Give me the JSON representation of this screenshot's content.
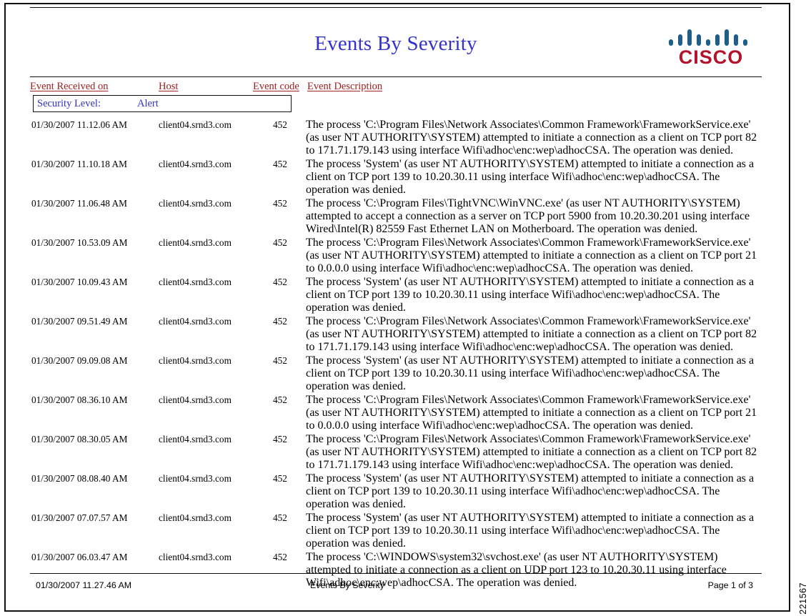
{
  "report": {
    "title": "Events By Severity",
    "logo": {
      "name": "cisco-logo",
      "wordmark": "CISCO",
      "bar_color": "#1d5f8a",
      "wordmark_color": "#b4122a"
    },
    "title_color": "#3333cc",
    "header_color": "#a02020"
  },
  "columns": {
    "received_on": "Event Received on",
    "host": "Host",
    "event_code": "Event code",
    "description": "Event Description"
  },
  "security_level": {
    "label": "Security Level:",
    "value": "Alert",
    "color": "#3333cc"
  },
  "rows": [
    {
      "time": "01/30/2007 11.12.06 AM",
      "host": "client04.srnd3.com",
      "code": "452",
      "description": "The process 'C:\\Program Files\\Network Associates\\Common Framework\\FrameworkService.exe' (as user NT AUTHORITY\\SYSTEM) attempted to initiate a connection as a client on TCP port 82 to 171.71.179.143 using interface Wifi\\adhoc\\enc:wep\\adhocCSA. The operation was denied."
    },
    {
      "time": "01/30/2007 11.10.18 AM",
      "host": "client04.srnd3.com",
      "code": "452",
      "description": "The process 'System' (as user NT AUTHORITY\\SYSTEM) attempted to initiate a connection as a client on TCP port 139 to 10.20.30.11 using interface Wifi\\adhoc\\enc:wep\\adhocCSA. The operation was denied."
    },
    {
      "time": "01/30/2007 11.06.48 AM",
      "host": "client04.srnd3.com",
      "code": "452",
      "description": "The process 'C:\\Program Files\\TightVNC\\WinVNC.exe' (as user NT AUTHORITY\\SYSTEM) attempted to accept a connection as a server on TCP port 5900 from 10.20.30.201 using interface Wired\\Intel(R) 82559 Fast Ethernet LAN on Motherboard. The operation was denied."
    },
    {
      "time": "01/30/2007 10.53.09 AM",
      "host": "client04.srnd3.com",
      "code": "452",
      "description": "The process 'C:\\Program Files\\Network Associates\\Common Framework\\FrameworkService.exe' (as user NT AUTHORITY\\SYSTEM) attempted to initiate a connection as a client on TCP port 21 to 0.0.0.0 using interface Wifi\\adhoc\\enc:wep\\adhocCSA. The operation was denied."
    },
    {
      "time": "01/30/2007 10.09.43 AM",
      "host": "client04.srnd3.com",
      "code": "452",
      "description": "The process 'System' (as user NT AUTHORITY\\SYSTEM) attempted to initiate a connection as a client on TCP port 139 to 10.20.30.11 using interface Wifi\\adhoc\\enc:wep\\adhocCSA. The operation was denied."
    },
    {
      "time": "01/30/2007 09.51.49 AM",
      "host": "client04.srnd3.com",
      "code": "452",
      "description": "The process 'C:\\Program Files\\Network Associates\\Common Framework\\FrameworkService.exe' (as user NT AUTHORITY\\SYSTEM) attempted to initiate a connection as a client on TCP port 82 to 171.71.179.143 using interface Wifi\\adhoc\\enc:wep\\adhocCSA. The operation was denied."
    },
    {
      "time": "01/30/2007 09.09.08 AM",
      "host": "client04.srnd3.com",
      "code": "452",
      "description": "The process 'System' (as user NT AUTHORITY\\SYSTEM) attempted to initiate a connection as a client on TCP port 139 to 10.20.30.11 using interface Wifi\\adhoc\\enc:wep\\adhocCSA. The operation was denied."
    },
    {
      "time": "01/30/2007 08.36.10 AM",
      "host": "client04.srnd3.com",
      "code": "452",
      "description": "The process 'C:\\Program Files\\Network Associates\\Common Framework\\FrameworkService.exe' (as user NT AUTHORITY\\SYSTEM) attempted to initiate a connection as a client on TCP port 21 to 0.0.0.0 using interface Wifi\\adhoc\\enc:wep\\adhocCSA. The operation was denied."
    },
    {
      "time": "01/30/2007 08.30.05 AM",
      "host": "client04.srnd3.com",
      "code": "452",
      "description": "The process 'C:\\Program Files\\Network Associates\\Common Framework\\FrameworkService.exe' (as user NT AUTHORITY\\SYSTEM) attempted to initiate a connection as a client on TCP port 82 to 171.71.179.143 using interface Wifi\\adhoc\\enc:wep\\adhocCSA. The operation was denied."
    },
    {
      "time": "01/30/2007 08.08.40 AM",
      "host": "client04.srnd3.com",
      "code": "452",
      "description": "The process 'System' (as user NT AUTHORITY\\SYSTEM) attempted to initiate a connection as a client on TCP port 139 to 10.20.30.11 using interface Wifi\\adhoc\\enc:wep\\adhocCSA. The operation was denied."
    },
    {
      "time": "01/30/2007 07.07.57 AM",
      "host": "client04.srnd3.com",
      "code": "452",
      "description": "The process 'System' (as user NT AUTHORITY\\SYSTEM) attempted to initiate a connection as a client on TCP port 139 to 10.20.30.11 using interface Wifi\\adhoc\\enc:wep\\adhocCSA. The operation was denied."
    },
    {
      "time": "01/30/2007 06.03.47 AM",
      "host": "client04.srnd3.com",
      "code": "452",
      "description": "The process 'C:\\WINDOWS\\system32\\svchost.exe' (as user NT AUTHORITY\\SYSTEM) attempted to initiate a connection as a client on UDP port 123 to 10.20.30.11 using interface Wifi\\adhoc\\enc:wep\\adhocCSA. The operation was denied."
    }
  ],
  "footer": {
    "generated": "01/30/2007 11.27.46 AM",
    "title": "Events By Severity",
    "page": "Page 1 of 3"
  },
  "figure_id": "221567"
}
